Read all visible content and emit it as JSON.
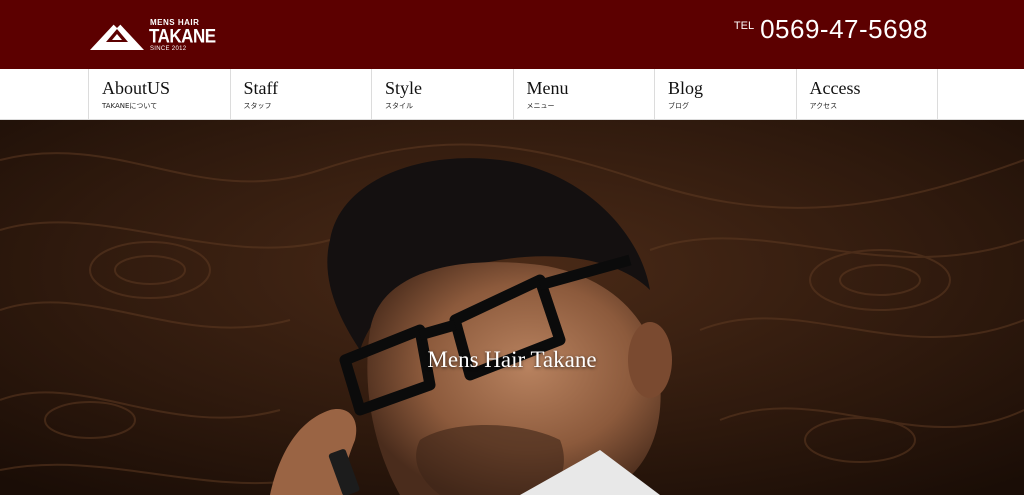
{
  "header": {
    "logo": {
      "small": "MENS HAIR",
      "name": "TAKANE",
      "since": "SINCE 2012"
    },
    "tel_label": "TEL",
    "tel_number": "0569-47-5698",
    "bg_color": "#5c0000"
  },
  "nav": {
    "items": [
      {
        "en": "AboutUS",
        "jp": "TAKANEについて"
      },
      {
        "en": "Staff",
        "jp": "スタッフ"
      },
      {
        "en": "Style",
        "jp": "スタイル"
      },
      {
        "en": "Menu",
        "jp": "メニュー"
      },
      {
        "en": "Blog",
        "jp": "ブログ"
      },
      {
        "en": "Access",
        "jp": "アクセス"
      }
    ]
  },
  "hero": {
    "title": "Mens Hair Takane"
  }
}
